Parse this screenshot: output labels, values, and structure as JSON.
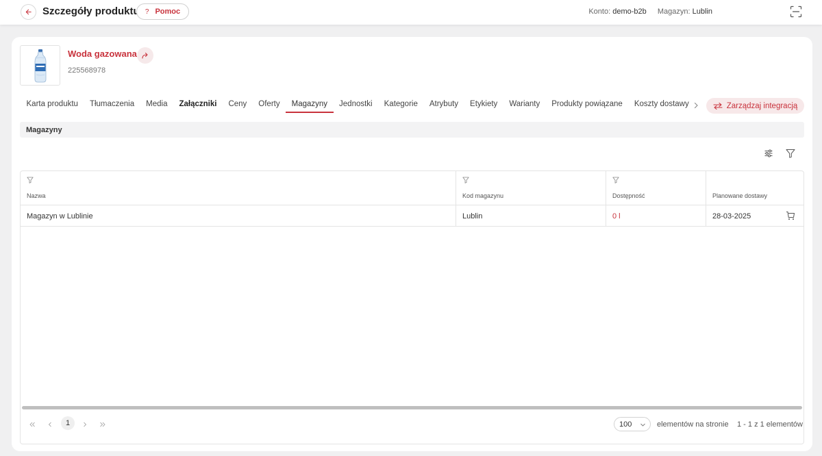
{
  "header": {
    "title": "Szczegóły produktu",
    "help_label": "Pomoc",
    "help_glyph": "?",
    "account_label": "Konto:",
    "account_value": "demo-b2b",
    "warehouse_label": "Magazyn:",
    "warehouse_value": "Lublin"
  },
  "product": {
    "name": "Woda gazowana",
    "code": "225568978"
  },
  "tabs": [
    {
      "label": "Karta produktu"
    },
    {
      "label": "Tłumaczenia"
    },
    {
      "label": "Media"
    },
    {
      "label": "Załączniki"
    },
    {
      "label": "Ceny"
    },
    {
      "label": "Oferty"
    },
    {
      "label": "Magazyny"
    },
    {
      "label": "Jednostki"
    },
    {
      "label": "Kategorie"
    },
    {
      "label": "Atrybuty"
    },
    {
      "label": "Etykiety"
    },
    {
      "label": "Warianty"
    },
    {
      "label": "Produkty powiązane"
    },
    {
      "label": "Koszty dostawy"
    }
  ],
  "manage_integration_label": "Zarządzaj integracją",
  "section_title": "Magazyny",
  "grid": {
    "columns": [
      "Nazwa",
      "Kod magazynu",
      "Dostępność",
      "Planowane dostawy"
    ],
    "rows": [
      {
        "name": "Magazyn w Lublinie",
        "code": "Lublin",
        "availability": "0 l",
        "planned": "28-03-2025"
      }
    ]
  },
  "pager": {
    "current_page": "1",
    "page_size": "100",
    "page_size_label": "elementów na stronie",
    "range_text": "1 - 1 z 1 elementów"
  },
  "colors": {
    "accent": "#c8323c",
    "accent_soft": "#f7e8e9"
  }
}
